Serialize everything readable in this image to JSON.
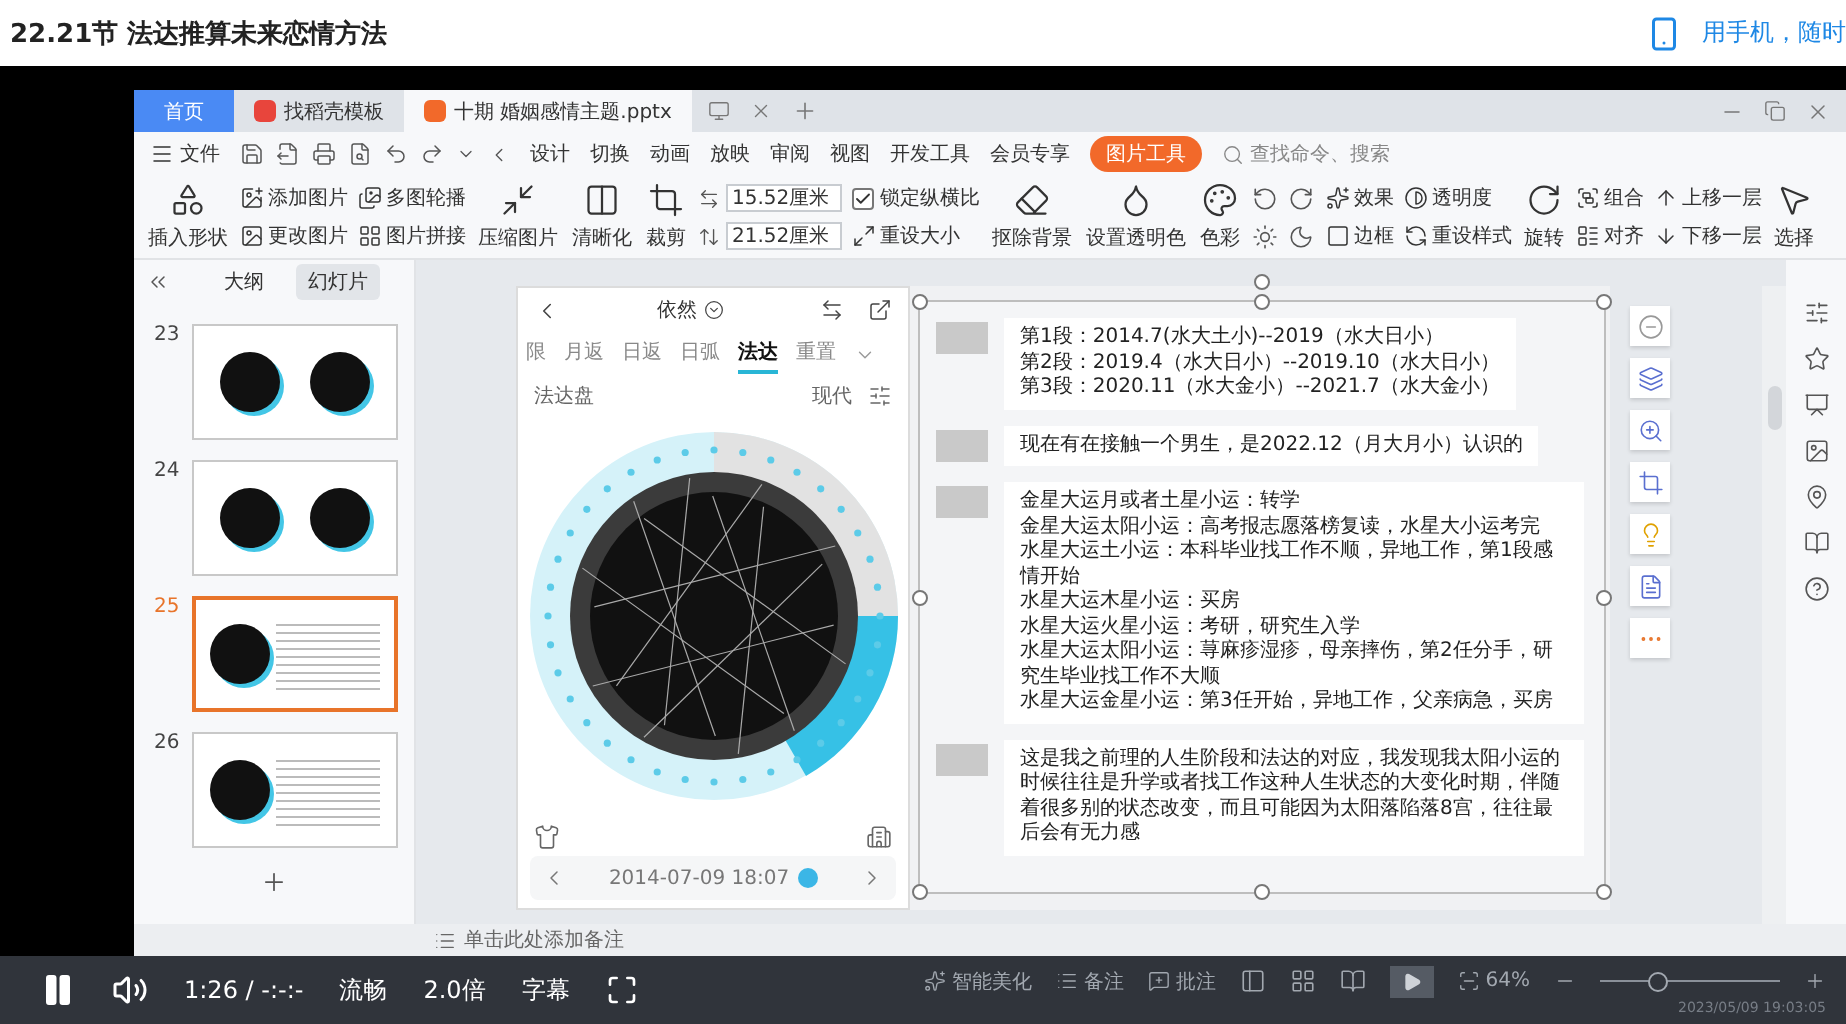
{
  "page_title": "22.21节 法达推算未来恋情方法",
  "mobile_link": "用手机，随时",
  "wps": {
    "tabs": [
      {
        "label": "首页",
        "selected": false,
        "kind": "home"
      },
      {
        "label": "找稻壳模板",
        "selected": false,
        "kind": "template"
      },
      {
        "label": "十期 婚姻感情主题.pptx",
        "selected": true,
        "kind": "document"
      }
    ],
    "file_menu": "文件",
    "menu": [
      "设计",
      "切换",
      "动画",
      "放映",
      "审阅",
      "视图",
      "开发工具",
      "会员专享"
    ],
    "context_tab": "图片工具",
    "search_placeholder": "查找命令、搜索",
    "ribbon": [
      {
        "kind": "big",
        "label": "插入形状"
      },
      {
        "kind": "stack",
        "items": [
          "添加图片",
          "更改图片"
        ]
      },
      {
        "kind": "stack",
        "items": [
          "多图轮播",
          "图片拼接"
        ]
      },
      {
        "kind": "big",
        "label": "压缩图片"
      },
      {
        "kind": "big",
        "label": "清晰化"
      },
      {
        "kind": "big",
        "label": "裁剪"
      },
      {
        "kind": "size",
        "width": "15.52厘米",
        "height": "21.52厘米"
      },
      {
        "kind": "check",
        "label": "锁定纵横比",
        "checked": true,
        "action": "重设大小"
      },
      {
        "kind": "big",
        "label": "抠除背景"
      },
      {
        "kind": "big",
        "label": "设置透明色"
      },
      {
        "kind": "big",
        "label": "色彩"
      },
      {
        "kind": "icons"
      },
      {
        "kind": "stack",
        "items": [
          "效果",
          "边框"
        ]
      },
      {
        "kind": "stack",
        "items": [
          "透明度",
          "重设样式"
        ]
      },
      {
        "kind": "big",
        "label": "旋转"
      },
      {
        "kind": "stack",
        "items": [
          "组合",
          "对齐"
        ]
      },
      {
        "kind": "stack",
        "items": [
          "上移一层",
          "下移一层"
        ]
      },
      {
        "kind": "big",
        "label": "选择"
      }
    ],
    "pane_tabs": [
      {
        "label": "大纲",
        "selected": false
      },
      {
        "label": "幻灯片",
        "selected": true
      }
    ],
    "slides": [
      {
        "number": "23",
        "selected": false,
        "kind": "two-charts"
      },
      {
        "number": "24",
        "selected": false,
        "kind": "two-charts"
      },
      {
        "number": "25",
        "selected": true,
        "kind": "chart-text"
      },
      {
        "number": "26",
        "selected": false,
        "kind": "chart-text"
      }
    ],
    "phone": {
      "name": "依然",
      "tabs": [
        {
          "label": "限",
          "selected": false
        },
        {
          "label": "月返",
          "selected": false
        },
        {
          "label": "日返",
          "selected": false
        },
        {
          "label": "日弧",
          "selected": false
        },
        {
          "label": "法达",
          "selected": true
        },
        {
          "label": "重置",
          "selected": false
        }
      ],
      "chart_label": "法达盘",
      "mode": "现代",
      "date": "2014-07-09 18:07"
    },
    "messages": [
      {
        "lines": [
          "第1段：2014.7(水大土小)--2019（水大日小）",
          "第2段：2019.4（水大日小）--2019.10（水大日小）",
          "第3段：2020.11（水大金小）--2021.7（水大金小）"
        ]
      },
      {
        "lines": [
          "现在有在接触一个男生，是2022.12（月大月小）认识的"
        ]
      },
      {
        "lines": [
          "金星大运月或者土星小运：转学",
          "金星大运太阳小运：高考报志愿落榜复读，水星大小运考完",
          "水星大运土小运：本科毕业找工作不顺，异地工作，第1段感情开始",
          "水星大运木星小运：买房",
          "水星大运火星小运：考研，研究生入学",
          "水星大运太阳小运：荨麻疹湿疹，母亲摔伤，第2任分手，研究生毕业找工作不大顺",
          "水星大运金星小运：第3任开始，异地工作，父亲病急，买房"
        ]
      },
      {
        "lines": [
          "这是我之前理的人生阶段和法达的对应，我发现我太阳小运的时候往往是升学或者找工作这种人生状态的大变化时期，伴随着很多别的状态改变，而且可能因为太阳落陷落8宫，往往最后会有无力感"
        ]
      }
    ],
    "notes_hint": "单击此处添加备注",
    "status": {
      "beautify": "智能美化",
      "notes": "备注",
      "comment": "批注",
      "zoom": "64%",
      "zoom_slider": {
        "level": 0.3
      }
    }
  },
  "player": {
    "time": "1:26 / -:-:-",
    "quality": "流畅",
    "speed": "2.0倍",
    "subtitles": "字幕",
    "timestamp": "2023/05/09 19:03:05"
  }
}
